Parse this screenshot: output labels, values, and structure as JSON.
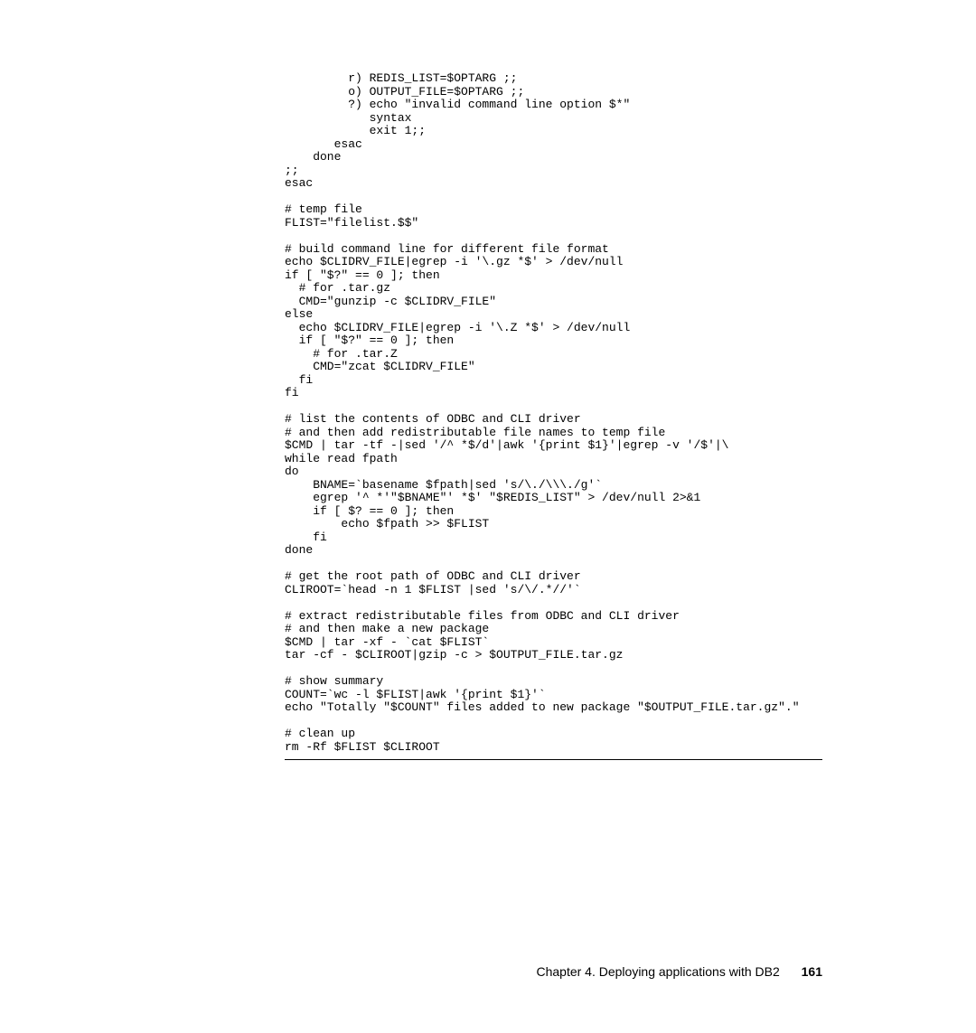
{
  "code": {
    "lines": [
      "         r) REDIS_LIST=$OPTARG ;;",
      "         o) OUTPUT_FILE=$OPTARG ;;",
      "         ?) echo \"invalid command line option $*\"",
      "            syntax",
      "            exit 1;;",
      "       esac",
      "    done",
      ";;",
      "esac",
      "",
      "# temp file",
      "FLIST=\"filelist.$$\"",
      "",
      "# build command line for different file format",
      "echo $CLIDRV_FILE|egrep -i '\\.gz *$' > /dev/null",
      "if [ \"$?\" == 0 ]; then",
      "  # for .tar.gz",
      "  CMD=\"gunzip -c $CLIDRV_FILE\"",
      "else",
      "  echo $CLIDRV_FILE|egrep -i '\\.Z *$' > /dev/null",
      "  if [ \"$?\" == 0 ]; then",
      "    # for .tar.Z",
      "    CMD=\"zcat $CLIDRV_FILE\"",
      "  fi",
      "fi",
      "",
      "# list the contents of ODBC and CLI driver",
      "# and then add redistributable file names to temp file",
      "$CMD | tar -tf -|sed '/^ *$/d'|awk '{print $1}'|egrep -v '/$'|\\",
      "while read fpath",
      "do",
      "    BNAME=`basename $fpath|sed 's/\\./\\\\\\./g'`",
      "    egrep '^ *'\"$BNAME\"' *$' \"$REDIS_LIST\" > /dev/null 2>&1",
      "    if [ $? == 0 ]; then",
      "        echo $fpath >> $FLIST",
      "    fi",
      "done",
      "",
      "# get the root path of ODBC and CLI driver",
      "CLIROOT=`head -n 1 $FLIST |sed 's/\\/.*//'`",
      "",
      "# extract redistributable files from ODBC and CLI driver",
      "# and then make a new package",
      "$CMD | tar -xf - `cat $FLIST`",
      "tar -cf - $CLIROOT|gzip -c > $OUTPUT_FILE.tar.gz",
      "",
      "# show summary",
      "COUNT=`wc -l $FLIST|awk '{print $1}'`",
      "echo \"Totally \"$COUNT\" files added to new package \"$OUTPUT_FILE.tar.gz\".\"",
      "",
      "# clean up",
      "rm -Rf $FLIST $CLIROOT"
    ]
  },
  "footer": {
    "chapter": "Chapter 4. Deploying applications with DB2",
    "page": "161"
  }
}
